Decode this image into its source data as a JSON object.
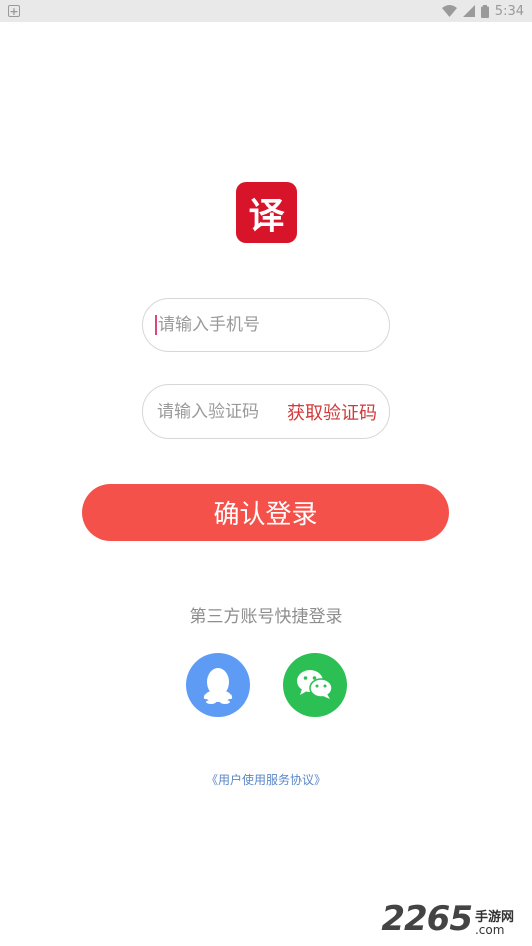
{
  "status_bar": {
    "time": "5:34",
    "icons": [
      "notification-icon",
      "wifi-icon",
      "signal-icon",
      "battery-icon"
    ]
  },
  "logo": {
    "char": "译",
    "color": "#d8142b"
  },
  "phone_field": {
    "placeholder": "请输入手机号",
    "value": ""
  },
  "code_field": {
    "placeholder": "请输入验证码",
    "value": "",
    "get_code_label": "获取验证码"
  },
  "confirm_button": {
    "label": "确认登录",
    "color": "#f5514b"
  },
  "third_party": {
    "label": "第三方账号快捷登录",
    "buttons": [
      {
        "icon": "qq-icon",
        "color": "#5e9bf4"
      },
      {
        "icon": "wechat-icon",
        "color": "#2cbf53"
      }
    ]
  },
  "agreement": {
    "label": "《用户使用服务协议》"
  },
  "watermark": {
    "text": "2265",
    "suffix": "手游网",
    "domain": ".com"
  }
}
